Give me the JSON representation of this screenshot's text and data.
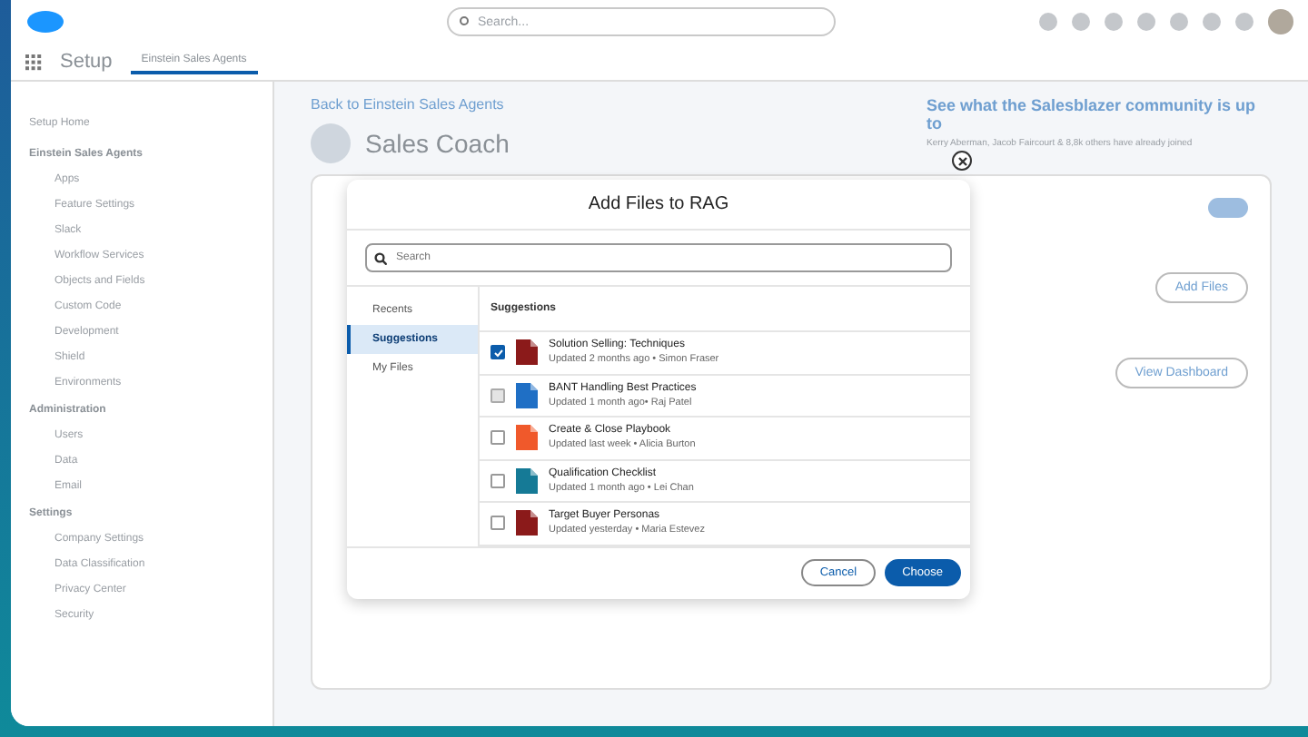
{
  "top_bar": {
    "search_placeholder": "Search..."
  },
  "app_bar": {
    "app_name": "Setup",
    "tab": "Einstein Sales Agents"
  },
  "sidebar": {
    "home": "Setup Home",
    "sections": [
      {
        "title": "Einstein Sales Agents",
        "items": [
          "Apps",
          "Feature Settings",
          "Slack",
          "Workflow Services",
          "Objects and Fields",
          "Custom Code",
          "Development",
          "Shield",
          "Environments"
        ]
      },
      {
        "title": "Administration",
        "items": [
          "Users",
          "Data",
          "Email"
        ]
      },
      {
        "title": "Settings",
        "items": [
          "Company Settings",
          "Data Classification",
          "Privacy Center",
          "Security"
        ]
      }
    ]
  },
  "page": {
    "back_link": "Back to Einstein Sales Agents",
    "title": "Sales Coach",
    "banner_title": "See what the Salesblazer community is up to",
    "banner_text": "Kerry Aberman, Jacob Faircourt & 8,8k others have already joined",
    "toggle_on": true,
    "buttons": [
      "Add Files",
      "View Dashboard"
    ]
  },
  "modal": {
    "title": "Add Files to RAG",
    "search_placeholder": "Search",
    "nav": [
      {
        "label": "Recents",
        "selected": false
      },
      {
        "label": "Suggestions",
        "selected": true
      },
      {
        "label": "My Files",
        "selected": false
      }
    ],
    "list_heading": "Suggestions",
    "files": [
      {
        "kind": "pdf",
        "name": "Solution Selling: Techniques",
        "meta": "Updated 2 months ago • Simon Fraser",
        "checked": true,
        "disabled": false
      },
      {
        "kind": "doc",
        "name": "BANT Handling Best Practices",
        "meta": "Updated 1 month ago• Raj Patel",
        "checked": false,
        "disabled": true
      },
      {
        "kind": "ppt",
        "name": "Create & Close Playbook",
        "meta": "Updated last week • Alicia Burton",
        "checked": false,
        "disabled": false
      },
      {
        "kind": "sheet",
        "name": "Qualification Checklist",
        "meta": "Updated 1 month ago • Lei Chan",
        "checked": false,
        "disabled": false
      },
      {
        "kind": "pdf",
        "name": "Target Buyer Personas",
        "meta": "Updated yesterday • Maria Estevez",
        "checked": false,
        "disabled": false
      }
    ],
    "cancel": "Cancel",
    "confirm": "Choose"
  }
}
